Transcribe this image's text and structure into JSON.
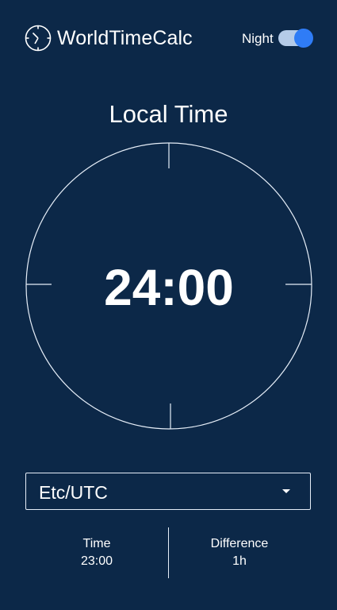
{
  "app": {
    "title": "WorldTimeCalc",
    "logo_icon": "clock-icon"
  },
  "header": {
    "night_label": "Night",
    "night_mode_enabled": true
  },
  "main": {
    "section_title": "Local Time",
    "dial_time": "24:00"
  },
  "timezone_select": {
    "selected": "Etc/UTC",
    "caret_icon": "caret-down-icon"
  },
  "info": {
    "time_label": "Time",
    "time_value": "23:00",
    "difference_label": "Difference",
    "difference_value": "1h"
  },
  "colors": {
    "background": "#0c2848",
    "text": "#ffffff",
    "toggle_track": "#b5cbe8",
    "toggle_knob": "#2f7cf6"
  }
}
